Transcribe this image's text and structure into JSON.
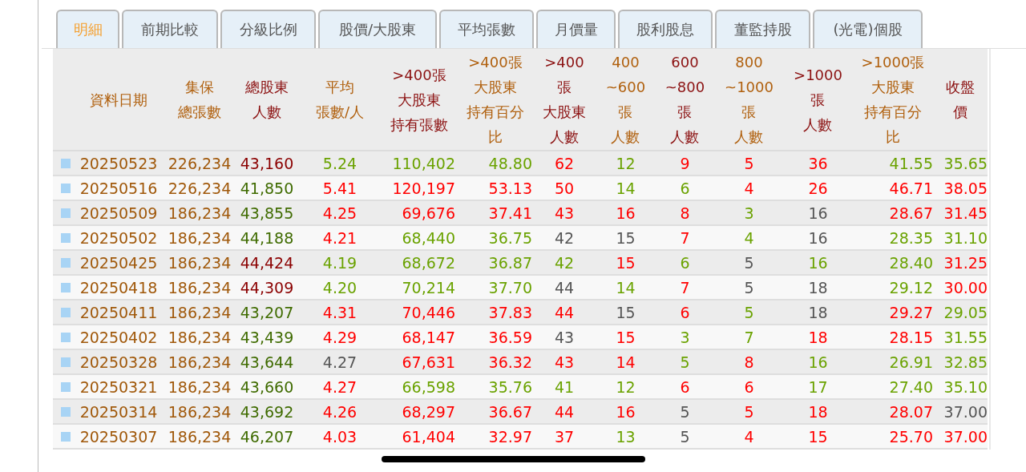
{
  "tabs": [
    {
      "label": "明細",
      "selected": true
    },
    {
      "label": "前期比較",
      "selected": false
    },
    {
      "label": "分級比例",
      "selected": false
    },
    {
      "label": "股價/大股東",
      "selected": false
    },
    {
      "label": "平均張數",
      "selected": false
    },
    {
      "label": "月價量",
      "selected": false
    },
    {
      "label": "股利股息",
      "selected": false
    },
    {
      "label": "董監持股",
      "selected": false
    },
    {
      "label": "(光電)個股",
      "selected": false
    }
  ],
  "table": {
    "columns": [
      {
        "label": "資料日期",
        "highlight": false
      },
      {
        "label": "集保總張數",
        "highlight": false
      },
      {
        "label": "總股東人數",
        "highlight": true
      },
      {
        "label": "平均張數/人",
        "highlight": false
      },
      {
        "label": ">400張大股東持有張數",
        "highlight": true
      },
      {
        "label": ">400張大股東持有百分比",
        "highlight": false
      },
      {
        "label": ">400張大股東人數",
        "highlight": true
      },
      {
        "label": "400~600張人數",
        "highlight": false
      },
      {
        "label": "600~800張人數",
        "highlight": true
      },
      {
        "label": "800~1000張人數",
        "highlight": false
      },
      {
        "label": ">1000張人數",
        "highlight": true
      },
      {
        "label": ">1000張大股東持有百分比",
        "highlight": false
      },
      {
        "label": "收盤價",
        "highlight": true
      }
    ],
    "rows": [
      [
        {
          "text": "20250523"
        },
        {
          "text": "226,234"
        },
        {
          "text": "43,160",
          "color": "#8b0000"
        },
        {
          "text": "5.24",
          "color": "#6aa200"
        },
        {
          "text": "110,402",
          "color": "#6aa200"
        },
        {
          "text": "48.80",
          "color": "#6aa200"
        },
        {
          "text": "62",
          "color": "#ff0000"
        },
        {
          "text": "12",
          "color": "#6aa200"
        },
        {
          "text": "9",
          "color": "#ff0000"
        },
        {
          "text": "5",
          "color": "#ff0000"
        },
        {
          "text": "36",
          "color": "#ff0000"
        },
        {
          "text": "41.55",
          "color": "#6aa200"
        },
        {
          "text": "35.65",
          "color": "#6aa200"
        }
      ],
      [
        {
          "text": "20250516"
        },
        {
          "text": "226,234"
        },
        {
          "text": "41,850",
          "color": "#3f6b00"
        },
        {
          "text": "5.41",
          "color": "#ff0000"
        },
        {
          "text": "120,197",
          "color": "#ff0000"
        },
        {
          "text": "53.13",
          "color": "#ff0000"
        },
        {
          "text": "50",
          "color": "#ff0000"
        },
        {
          "text": "14",
          "color": "#6aa200"
        },
        {
          "text": "6",
          "color": "#6aa200"
        },
        {
          "text": "4",
          "color": "#ff0000"
        },
        {
          "text": "26",
          "color": "#ff0000"
        },
        {
          "text": "46.71",
          "color": "#ff0000"
        },
        {
          "text": "38.05",
          "color": "#ff0000"
        }
      ],
      [
        {
          "text": "20250509"
        },
        {
          "text": "186,234"
        },
        {
          "text": "43,855",
          "color": "#3f6b00"
        },
        {
          "text": "4.25",
          "color": "#ff0000"
        },
        {
          "text": "69,676",
          "color": "#ff0000"
        },
        {
          "text": "37.41",
          "color": "#ff0000"
        },
        {
          "text": "43",
          "color": "#ff0000"
        },
        {
          "text": "16",
          "color": "#ff0000"
        },
        {
          "text": "8",
          "color": "#ff0000"
        },
        {
          "text": "3",
          "color": "#6aa200"
        },
        {
          "text": "16",
          "color": "#555555"
        },
        {
          "text": "28.67",
          "color": "#ff0000"
        },
        {
          "text": "31.45",
          "color": "#ff0000"
        }
      ],
      [
        {
          "text": "20250502"
        },
        {
          "text": "186,234"
        },
        {
          "text": "44,188",
          "color": "#3f6b00"
        },
        {
          "text": "4.21",
          "color": "#ff0000"
        },
        {
          "text": "68,440",
          "color": "#6aa200"
        },
        {
          "text": "36.75",
          "color": "#6aa200"
        },
        {
          "text": "42",
          "color": "#555555"
        },
        {
          "text": "15",
          "color": "#555555"
        },
        {
          "text": "7",
          "color": "#ff0000"
        },
        {
          "text": "4",
          "color": "#6aa200"
        },
        {
          "text": "16",
          "color": "#555555"
        },
        {
          "text": "28.35",
          "color": "#6aa200"
        },
        {
          "text": "31.10",
          "color": "#6aa200"
        }
      ],
      [
        {
          "text": "20250425"
        },
        {
          "text": "186,234"
        },
        {
          "text": "44,424",
          "color": "#8b0000"
        },
        {
          "text": "4.19",
          "color": "#6aa200"
        },
        {
          "text": "68,672",
          "color": "#6aa200"
        },
        {
          "text": "36.87",
          "color": "#6aa200"
        },
        {
          "text": "42",
          "color": "#6aa200"
        },
        {
          "text": "15",
          "color": "#ff0000"
        },
        {
          "text": "6",
          "color": "#6aa200"
        },
        {
          "text": "5",
          "color": "#555555"
        },
        {
          "text": "16",
          "color": "#6aa200"
        },
        {
          "text": "28.40",
          "color": "#6aa200"
        },
        {
          "text": "31.25",
          "color": "#ff0000"
        }
      ],
      [
        {
          "text": "20250418"
        },
        {
          "text": "186,234"
        },
        {
          "text": "44,309",
          "color": "#8b0000"
        },
        {
          "text": "4.20",
          "color": "#6aa200"
        },
        {
          "text": "70,214",
          "color": "#6aa200"
        },
        {
          "text": "37.70",
          "color": "#6aa200"
        },
        {
          "text": "44",
          "color": "#555555"
        },
        {
          "text": "14",
          "color": "#6aa200"
        },
        {
          "text": "7",
          "color": "#ff0000"
        },
        {
          "text": "5",
          "color": "#555555"
        },
        {
          "text": "18",
          "color": "#555555"
        },
        {
          "text": "29.12",
          "color": "#6aa200"
        },
        {
          "text": "30.00",
          "color": "#ff0000"
        }
      ],
      [
        {
          "text": "20250411"
        },
        {
          "text": "186,234"
        },
        {
          "text": "43,207",
          "color": "#3f6b00"
        },
        {
          "text": "4.31",
          "color": "#ff0000"
        },
        {
          "text": "70,446",
          "color": "#ff0000"
        },
        {
          "text": "37.83",
          "color": "#ff0000"
        },
        {
          "text": "44",
          "color": "#ff0000"
        },
        {
          "text": "15",
          "color": "#555555"
        },
        {
          "text": "6",
          "color": "#ff0000"
        },
        {
          "text": "5",
          "color": "#6aa200"
        },
        {
          "text": "18",
          "color": "#555555"
        },
        {
          "text": "29.27",
          "color": "#ff0000"
        },
        {
          "text": "29.05",
          "color": "#6aa200"
        }
      ],
      [
        {
          "text": "20250402"
        },
        {
          "text": "186,234"
        },
        {
          "text": "43,439",
          "color": "#3f6b00"
        },
        {
          "text": "4.29",
          "color": "#ff0000"
        },
        {
          "text": "68,147",
          "color": "#ff0000"
        },
        {
          "text": "36.59",
          "color": "#ff0000"
        },
        {
          "text": "43",
          "color": "#555555"
        },
        {
          "text": "15",
          "color": "#ff0000"
        },
        {
          "text": "3",
          "color": "#6aa200"
        },
        {
          "text": "7",
          "color": "#6aa200"
        },
        {
          "text": "18",
          "color": "#ff0000"
        },
        {
          "text": "28.15",
          "color": "#ff0000"
        },
        {
          "text": "31.55",
          "color": "#6aa200"
        }
      ],
      [
        {
          "text": "20250328"
        },
        {
          "text": "186,234"
        },
        {
          "text": "43,644",
          "color": "#3f6b00"
        },
        {
          "text": "4.27",
          "color": "#555555"
        },
        {
          "text": "67,631",
          "color": "#ff0000"
        },
        {
          "text": "36.32",
          "color": "#ff0000"
        },
        {
          "text": "43",
          "color": "#ff0000"
        },
        {
          "text": "14",
          "color": "#ff0000"
        },
        {
          "text": "5",
          "color": "#6aa200"
        },
        {
          "text": "8",
          "color": "#ff0000"
        },
        {
          "text": "16",
          "color": "#6aa200"
        },
        {
          "text": "26.91",
          "color": "#6aa200"
        },
        {
          "text": "32.85",
          "color": "#6aa200"
        }
      ],
      [
        {
          "text": "20250321"
        },
        {
          "text": "186,234"
        },
        {
          "text": "43,660",
          "color": "#3f6b00"
        },
        {
          "text": "4.27",
          "color": "#ff0000"
        },
        {
          "text": "66,598",
          "color": "#6aa200"
        },
        {
          "text": "35.76",
          "color": "#6aa200"
        },
        {
          "text": "41",
          "color": "#6aa200"
        },
        {
          "text": "12",
          "color": "#6aa200"
        },
        {
          "text": "6",
          "color": "#ff0000"
        },
        {
          "text": "6",
          "color": "#ff0000"
        },
        {
          "text": "17",
          "color": "#6aa200"
        },
        {
          "text": "27.40",
          "color": "#6aa200"
        },
        {
          "text": "35.10",
          "color": "#6aa200"
        }
      ],
      [
        {
          "text": "20250314"
        },
        {
          "text": "186,234"
        },
        {
          "text": "43,692",
          "color": "#3f6b00"
        },
        {
          "text": "4.26",
          "color": "#ff0000"
        },
        {
          "text": "68,297",
          "color": "#ff0000"
        },
        {
          "text": "36.67",
          "color": "#ff0000"
        },
        {
          "text": "44",
          "color": "#ff0000"
        },
        {
          "text": "16",
          "color": "#ff0000"
        },
        {
          "text": "5",
          "color": "#555555"
        },
        {
          "text": "5",
          "color": "#ff0000"
        },
        {
          "text": "18",
          "color": "#ff0000"
        },
        {
          "text": "28.07",
          "color": "#ff0000"
        },
        {
          "text": "37.00",
          "color": "#555555"
        }
      ],
      [
        {
          "text": "20250307"
        },
        {
          "text": "186,234"
        },
        {
          "text": "46,207",
          "color": "#3f6b00"
        },
        {
          "text": "4.03",
          "color": "#ff0000"
        },
        {
          "text": "61,404",
          "color": "#ff0000"
        },
        {
          "text": "32.97",
          "color": "#ff0000"
        },
        {
          "text": "37",
          "color": "#ff0000"
        },
        {
          "text": "13",
          "color": "#6aa200"
        },
        {
          "text": "5",
          "color": "#555555"
        },
        {
          "text": "4",
          "color": "#ff0000"
        },
        {
          "text": "15",
          "color": "#ff0000"
        },
        {
          "text": "25.70",
          "color": "#ff0000"
        },
        {
          "text": "37.00",
          "color": "#ff0000"
        }
      ]
    ]
  }
}
